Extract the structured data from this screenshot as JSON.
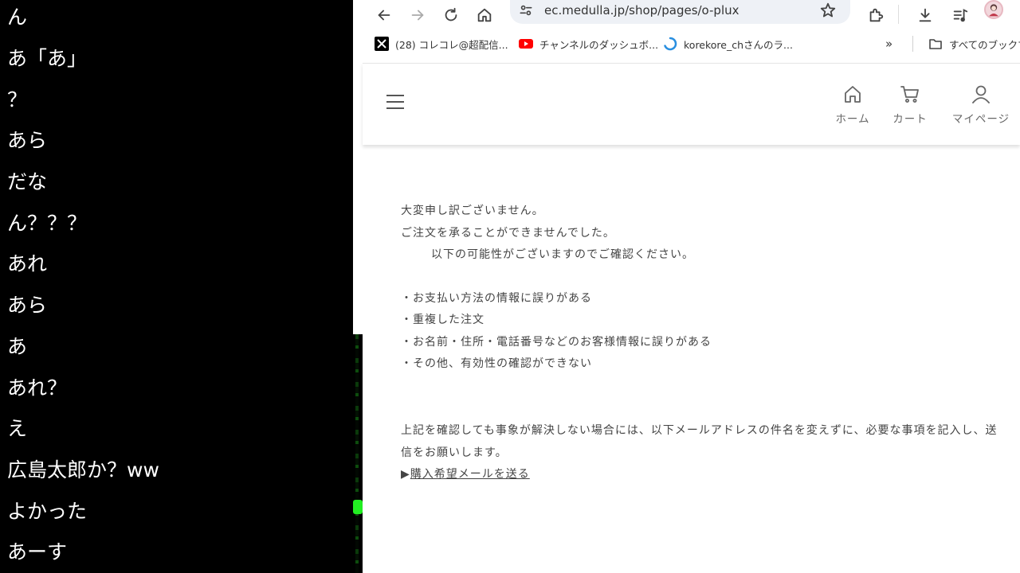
{
  "chat": {
    "lines": [
      "ん",
      "あ「あ」",
      "？",
      "あら",
      "だな",
      "ん？？？",
      "あれ",
      "あら",
      "あ",
      "あれ？",
      "え",
      "広島太郎か？ww",
      "よかった",
      "あーす"
    ]
  },
  "browser": {
    "url": "ec.medulla.jp/shop/pages/o-plux",
    "icons": [
      "back-icon",
      "forward-icon",
      "reload-icon",
      "home-icon",
      "site-settings-icon",
      "star-icon",
      "extensions-icon",
      "download-icon",
      "media-icon",
      "profile-avatar"
    ],
    "bookmarks": [
      {
        "label": "(28) コレコレ@超配信...",
        "icon": "x-logo-icon"
      },
      {
        "label": "チャンネルのダッシュボ...",
        "icon": "youtube-icon"
      },
      {
        "label": "korekore_chさんのラ...",
        "icon": "loading-icon"
      }
    ],
    "overflow_label": "»",
    "all_bookmarks_label": "すべてのブックマ"
  },
  "site": {
    "nav": {
      "home": "ホーム",
      "cart": "カート",
      "mypage": "マイページ"
    },
    "message": {
      "line1": "大変申し訳ございません。",
      "line2": "ご注文を承ることができませんでした。",
      "line3": "以下の可能性がございますのでご確認ください。",
      "reasons": [
        "・お支払い方法の情報に誤りがある",
        "・重複した注文",
        "・お名前・住所・電話番号などのお客様情報に誤りがある",
        "・その他、有効性の確認ができない"
      ],
      "instruction": "上記を確認しても事象が解決しない場合には、以下メールアドレスの件名を変えずに、必要な事項を記入し、送信をお願いします。",
      "link_prefix": "▶",
      "link_text": "購入希望メールを送る"
    }
  },
  "colors": {
    "chat_bg": "#000000",
    "chat_text": "#ffffff",
    "page_text": "#444444",
    "youtube_red": "#ff0000",
    "green_dot": "#22ee22"
  }
}
